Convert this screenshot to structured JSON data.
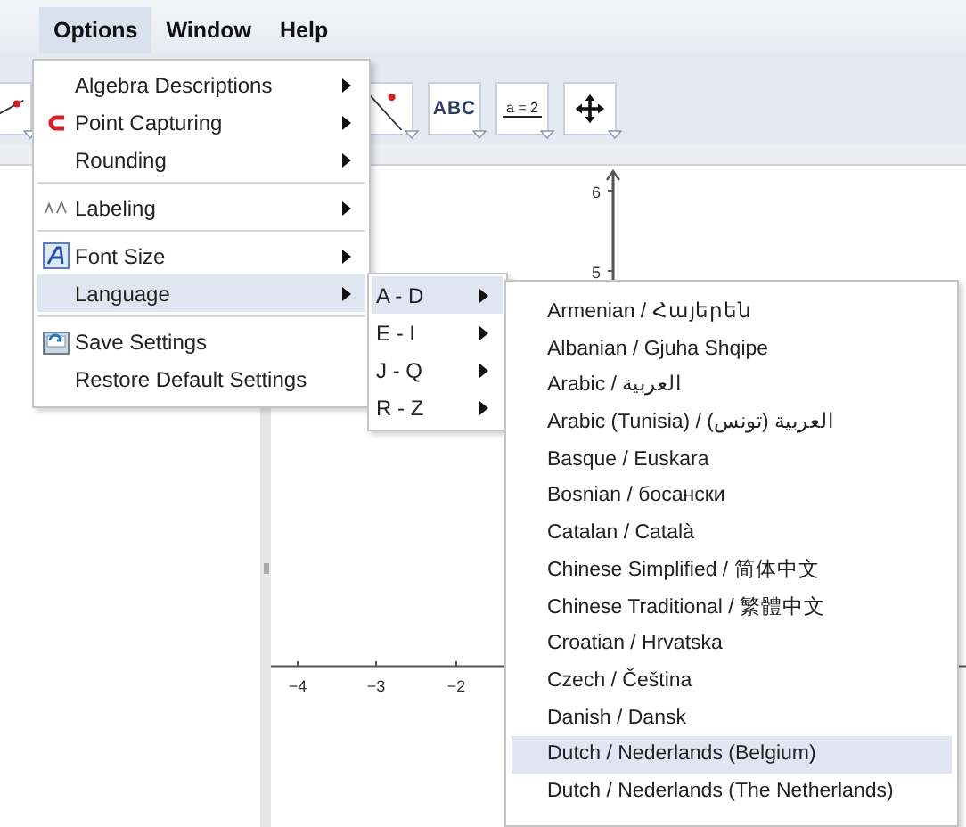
{
  "menubar": [
    {
      "label": "Options",
      "selected": true
    },
    {
      "label": "Window",
      "selected": false
    },
    {
      "label": "Help",
      "selected": false
    }
  ],
  "toolbar": {
    "tools": [
      {
        "kind": "points"
      },
      {
        "kind": "line"
      },
      {
        "kind": "text",
        "label": "ABC"
      },
      {
        "kind": "slider",
        "label": "a = 2"
      },
      {
        "kind": "move"
      }
    ]
  },
  "graphics": {
    "y_labels": [
      "6",
      "5"
    ],
    "x_labels": [
      "−4",
      "−3",
      "−2"
    ]
  },
  "options_menu": {
    "groups": [
      [
        {
          "label": "Algebra Descriptions",
          "submenu": true,
          "selected": false
        },
        {
          "label": "Point Capturing",
          "submenu": true,
          "selected": false
        },
        {
          "label": "Rounding",
          "submenu": true,
          "selected": false
        }
      ],
      [
        {
          "label": "Labeling",
          "submenu": true,
          "selected": false
        }
      ],
      [
        {
          "label": "Font Size",
          "submenu": true,
          "selected": false
        },
        {
          "label": "Language",
          "submenu": true,
          "selected": true
        }
      ],
      [
        {
          "label": "Save Settings",
          "submenu": false,
          "selected": false
        },
        {
          "label": "Restore Default Settings",
          "submenu": false,
          "selected": false
        }
      ]
    ]
  },
  "language_ranges": [
    {
      "label": "A - D",
      "submenu": true,
      "selected": true
    },
    {
      "label": "E - I",
      "submenu": true,
      "selected": false
    },
    {
      "label": "J - Q",
      "submenu": true,
      "selected": false
    },
    {
      "label": "R - Z",
      "submenu": true,
      "selected": false
    }
  ],
  "languages": [
    {
      "label": "Armenian / Հայերեն",
      "selected": false
    },
    {
      "label": "Albanian / Gjuha Shqipe",
      "selected": false
    },
    {
      "label": "Arabic / العربية",
      "selected": false
    },
    {
      "label": "Arabic (Tunisia) / (العربية (تونس",
      "selected": false
    },
    {
      "label": "Basque / Euskara",
      "selected": false
    },
    {
      "label": "Bosnian / босански",
      "selected": false
    },
    {
      "label": "Catalan / Català",
      "selected": false
    },
    {
      "label": "Chinese Simplified / 简体中文",
      "selected": false
    },
    {
      "label": "Chinese Traditional / 繁體中文",
      "selected": false
    },
    {
      "label": "Croatian / Hrvatska",
      "selected": false
    },
    {
      "label": "Czech / Čeština",
      "selected": false
    },
    {
      "label": "Danish / Dansk",
      "selected": false
    },
    {
      "label": "Dutch / Nederlands (Belgium)",
      "selected": true
    },
    {
      "label": "Dutch / Nederlands (The Netherlands)",
      "selected": false
    }
  ]
}
